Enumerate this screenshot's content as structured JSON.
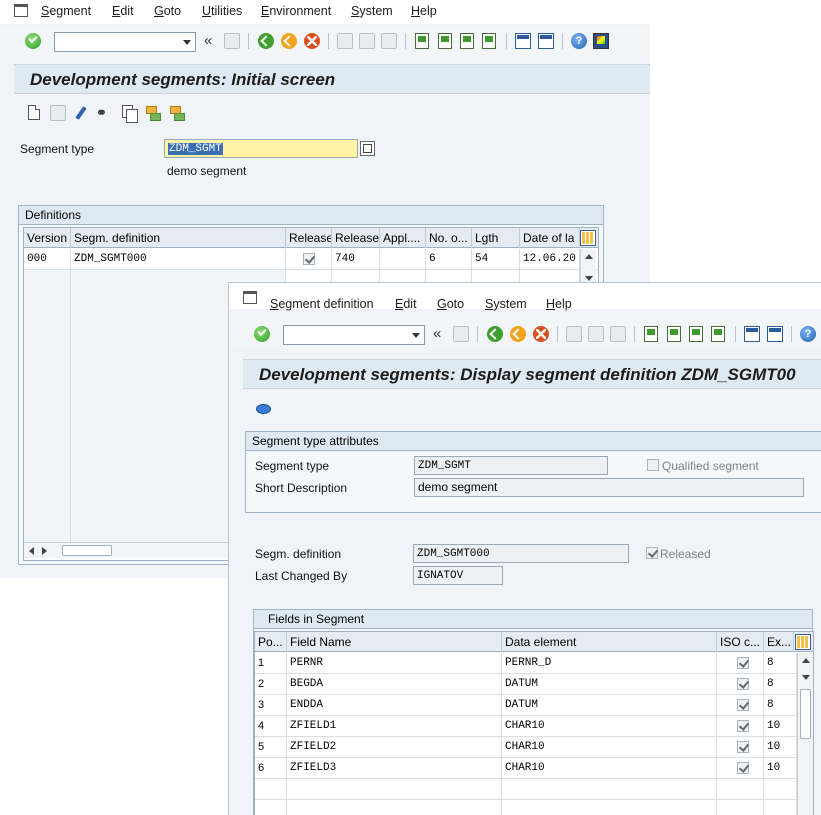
{
  "window1": {
    "menu": [
      "Segment",
      "Edit",
      "Goto",
      "Utilities",
      "Environment",
      "System",
      "Help"
    ],
    "title": "Development segments: Initial screen",
    "segment_type_label": "Segment type",
    "segment_type_value": "ZDM_SGMT",
    "segment_type_description": "demo segment",
    "definitions_title": "Definitions",
    "columns": [
      "Version",
      "Segm. definition",
      "Release",
      "Release",
      "Appl....",
      "No. o...",
      "Lgth",
      "Date of la"
    ],
    "rows": [
      {
        "version": "000",
        "definition": "ZDM_SGMT000",
        "released": true,
        "release": "740",
        "appl": "",
        "no": "6",
        "lgth": "54",
        "date": "12.06.20"
      }
    ]
  },
  "window2": {
    "menu": [
      "Segment definition",
      "Edit",
      "Goto",
      "System",
      "Help"
    ],
    "title": "Development segments: Display segment definition ZDM_SGMT00",
    "attributes_title": "Segment type attributes",
    "segment_type_label": "Segment type",
    "segment_type_value": "ZDM_SGMT",
    "qualified_label": "Qualified segment",
    "qualified_checked": false,
    "short_desc_label": "Short Description",
    "short_desc_value": "demo segment",
    "segm_def_label": "Segm. definition",
    "segm_def_value": "ZDM_SGMT000",
    "released_label": "Released",
    "released_checked": true,
    "last_changed_label": "Last Changed By",
    "last_changed_value": "IGNATOV",
    "fields_title": "Fields in Segment",
    "columns": [
      "Po...",
      "Field Name",
      "Data element",
      "ISO c...",
      "Ex..."
    ],
    "fields": [
      {
        "pos": "1",
        "name": "PERNR",
        "element": "PERNR_D",
        "iso": true,
        "ex": "8"
      },
      {
        "pos": "2",
        "name": "BEGDA",
        "element": "DATUM",
        "iso": true,
        "ex": "8"
      },
      {
        "pos": "3",
        "name": "ENDDA",
        "element": "DATUM",
        "iso": true,
        "ex": "8"
      },
      {
        "pos": "4",
        "name": "ZFIELD1",
        "element": "CHAR10",
        "iso": true,
        "ex": "10"
      },
      {
        "pos": "5",
        "name": "ZFIELD2",
        "element": "CHAR10",
        "iso": true,
        "ex": "10"
      },
      {
        "pos": "6",
        "name": "ZFIELD3",
        "element": "CHAR10",
        "iso": true,
        "ex": "10"
      }
    ]
  },
  "icons": {
    "enter": "check-icon",
    "help": "?",
    "back": "back-icon",
    "exit": "exit-icon",
    "cancel": "cancel-icon"
  },
  "colors": {
    "title_band": "#dfe9f2",
    "active_field": "#fff3a6",
    "required_marker": "#d12020"
  }
}
